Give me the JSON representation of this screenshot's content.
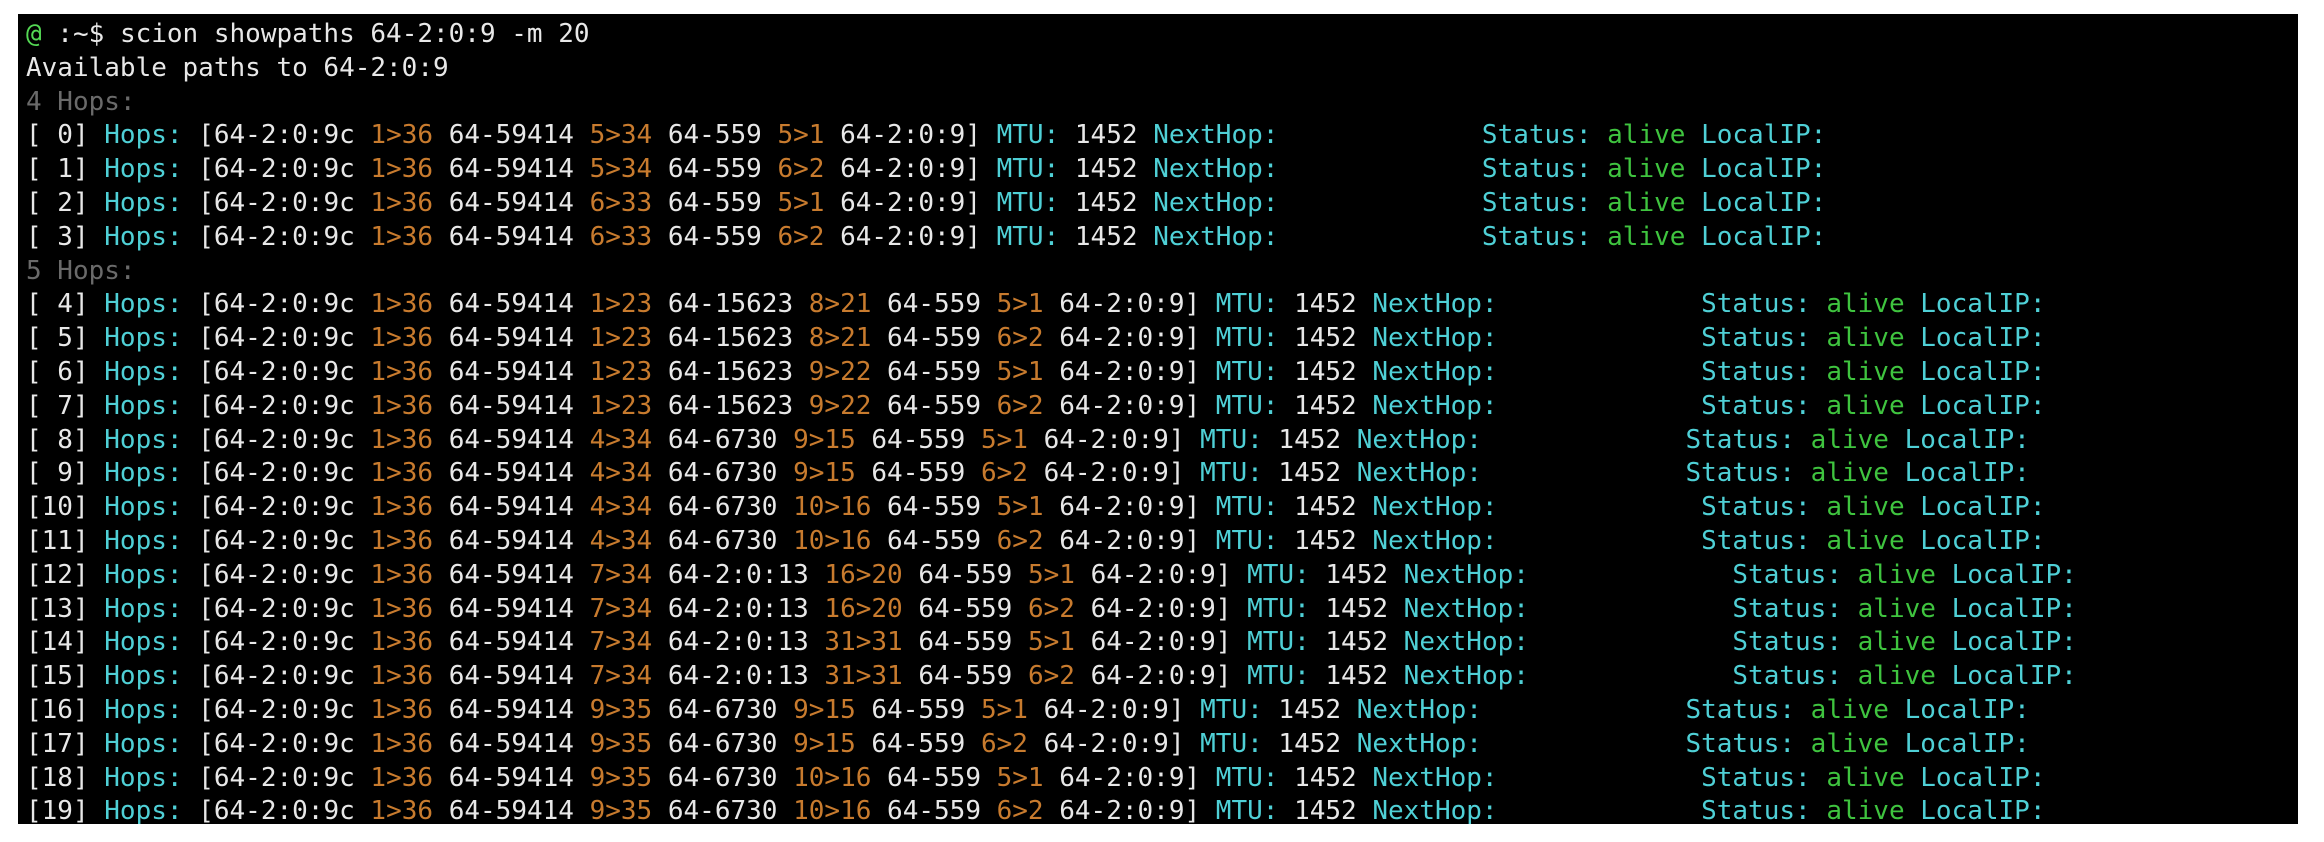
{
  "terminal": {
    "prompt_user": "@",
    "prompt_path": " :~$ ",
    "command": "scion showpaths 64-2:0:9 -m 20",
    "header": "Available paths to 64-2:0:9",
    "labels": {
      "hops": "Hops:",
      "mtu": "MTU:",
      "nexthop": "NextHop:",
      "status": "Status:",
      "localip": "LocalIP:"
    },
    "groups": [
      {
        "title": "4 Hops:",
        "paths": [
          {
            "idx": "[ 0]",
            "segs": [
              [
                "64-2:0:9c",
                "1>36"
              ],
              [
                "64-59414",
                "5>34"
              ],
              [
                "64-559",
                "5>1"
              ]
            ],
            "dst": "64-2:0:9]",
            "mtu": "1452",
            "status": "alive"
          },
          {
            "idx": "[ 1]",
            "segs": [
              [
                "64-2:0:9c",
                "1>36"
              ],
              [
                "64-59414",
                "5>34"
              ],
              [
                "64-559",
                "6>2"
              ]
            ],
            "dst": "64-2:0:9]",
            "mtu": "1452",
            "status": "alive"
          },
          {
            "idx": "[ 2]",
            "segs": [
              [
                "64-2:0:9c",
                "1>36"
              ],
              [
                "64-59414",
                "6>33"
              ],
              [
                "64-559",
                "5>1"
              ]
            ],
            "dst": "64-2:0:9]",
            "mtu": "1452",
            "status": "alive"
          },
          {
            "idx": "[ 3]",
            "segs": [
              [
                "64-2:0:9c",
                "1>36"
              ],
              [
                "64-59414",
                "6>33"
              ],
              [
                "64-559",
                "6>2"
              ]
            ],
            "dst": "64-2:0:9]",
            "mtu": "1452",
            "status": "alive"
          }
        ]
      },
      {
        "title": "5 Hops:",
        "paths": [
          {
            "idx": "[ 4]",
            "segs": [
              [
                "64-2:0:9c",
                "1>36"
              ],
              [
                "64-59414",
                "1>23"
              ],
              [
                "64-15623",
                "8>21"
              ],
              [
                "64-559",
                "5>1"
              ]
            ],
            "dst": "64-2:0:9]",
            "mtu": "1452",
            "status": "alive"
          },
          {
            "idx": "[ 5]",
            "segs": [
              [
                "64-2:0:9c",
                "1>36"
              ],
              [
                "64-59414",
                "1>23"
              ],
              [
                "64-15623",
                "8>21"
              ],
              [
                "64-559",
                "6>2"
              ]
            ],
            "dst": "64-2:0:9]",
            "mtu": "1452",
            "status": "alive"
          },
          {
            "idx": "[ 6]",
            "segs": [
              [
                "64-2:0:9c",
                "1>36"
              ],
              [
                "64-59414",
                "1>23"
              ],
              [
                "64-15623",
                "9>22"
              ],
              [
                "64-559",
                "5>1"
              ]
            ],
            "dst": "64-2:0:9]",
            "mtu": "1452",
            "status": "alive"
          },
          {
            "idx": "[ 7]",
            "segs": [
              [
                "64-2:0:9c",
                "1>36"
              ],
              [
                "64-59414",
                "1>23"
              ],
              [
                "64-15623",
                "9>22"
              ],
              [
                "64-559",
                "6>2"
              ]
            ],
            "dst": "64-2:0:9]",
            "mtu": "1452",
            "status": "alive"
          },
          {
            "idx": "[ 8]",
            "segs": [
              [
                "64-2:0:9c",
                "1>36"
              ],
              [
                "64-59414",
                "4>34"
              ],
              [
                "64-6730",
                "9>15"
              ],
              [
                "64-559",
                "5>1"
              ]
            ],
            "dst": "64-2:0:9]",
            "mtu": "1452",
            "status": "alive"
          },
          {
            "idx": "[ 9]",
            "segs": [
              [
                "64-2:0:9c",
                "1>36"
              ],
              [
                "64-59414",
                "4>34"
              ],
              [
                "64-6730",
                "9>15"
              ],
              [
                "64-559",
                "6>2"
              ]
            ],
            "dst": "64-2:0:9]",
            "mtu": "1452",
            "status": "alive"
          },
          {
            "idx": "[10]",
            "segs": [
              [
                "64-2:0:9c",
                "1>36"
              ],
              [
                "64-59414",
                "4>34"
              ],
              [
                "64-6730",
                "10>16"
              ],
              [
                "64-559",
                "5>1"
              ]
            ],
            "dst": "64-2:0:9]",
            "mtu": "1452",
            "status": "alive"
          },
          {
            "idx": "[11]",
            "segs": [
              [
                "64-2:0:9c",
                "1>36"
              ],
              [
                "64-59414",
                "4>34"
              ],
              [
                "64-6730",
                "10>16"
              ],
              [
                "64-559",
                "6>2"
              ]
            ],
            "dst": "64-2:0:9]",
            "mtu": "1452",
            "status": "alive"
          },
          {
            "idx": "[12]",
            "segs": [
              [
                "64-2:0:9c",
                "1>36"
              ],
              [
                "64-59414",
                "7>34"
              ],
              [
                "64-2:0:13",
                "16>20"
              ],
              [
                "64-559",
                "5>1"
              ]
            ],
            "dst": "64-2:0:9]",
            "mtu": "1452",
            "status": "alive"
          },
          {
            "idx": "[13]",
            "segs": [
              [
                "64-2:0:9c",
                "1>36"
              ],
              [
                "64-59414",
                "7>34"
              ],
              [
                "64-2:0:13",
                "16>20"
              ],
              [
                "64-559",
                "6>2"
              ]
            ],
            "dst": "64-2:0:9]",
            "mtu": "1452",
            "status": "alive"
          },
          {
            "idx": "[14]",
            "segs": [
              [
                "64-2:0:9c",
                "1>36"
              ],
              [
                "64-59414",
                "7>34"
              ],
              [
                "64-2:0:13",
                "31>31"
              ],
              [
                "64-559",
                "5>1"
              ]
            ],
            "dst": "64-2:0:9]",
            "mtu": "1452",
            "status": "alive"
          },
          {
            "idx": "[15]",
            "segs": [
              [
                "64-2:0:9c",
                "1>36"
              ],
              [
                "64-59414",
                "7>34"
              ],
              [
                "64-2:0:13",
                "31>31"
              ],
              [
                "64-559",
                "6>2"
              ]
            ],
            "dst": "64-2:0:9]",
            "mtu": "1452",
            "status": "alive"
          },
          {
            "idx": "[16]",
            "segs": [
              [
                "64-2:0:9c",
                "1>36"
              ],
              [
                "64-59414",
                "9>35"
              ],
              [
                "64-6730",
                "9>15"
              ],
              [
                "64-559",
                "5>1"
              ]
            ],
            "dst": "64-2:0:9]",
            "mtu": "1452",
            "status": "alive"
          },
          {
            "idx": "[17]",
            "segs": [
              [
                "64-2:0:9c",
                "1>36"
              ],
              [
                "64-59414",
                "9>35"
              ],
              [
                "64-6730",
                "9>15"
              ],
              [
                "64-559",
                "6>2"
              ]
            ],
            "dst": "64-2:0:9]",
            "mtu": "1452",
            "status": "alive"
          },
          {
            "idx": "[18]",
            "segs": [
              [
                "64-2:0:9c",
                "1>36"
              ],
              [
                "64-59414",
                "9>35"
              ],
              [
                "64-6730",
                "10>16"
              ],
              [
                "64-559",
                "5>1"
              ]
            ],
            "dst": "64-2:0:9]",
            "mtu": "1452",
            "status": "alive"
          },
          {
            "idx": "[19]",
            "segs": [
              [
                "64-2:0:9c",
                "1>36"
              ],
              [
                "64-59414",
                "9>35"
              ],
              [
                "64-6730",
                "10>16"
              ],
              [
                "64-559",
                "6>2"
              ]
            ],
            "dst": "64-2:0:9]",
            "mtu": "1452",
            "status": "alive"
          }
        ]
      }
    ]
  },
  "colors": {
    "background": "#000000",
    "text": "#e8e8e8",
    "prompt": "#54d854",
    "label": "#4fd0d6",
    "interface": "#c87b2e",
    "status_ok": "#3fc43f",
    "group_title": "#6a6a6a"
  }
}
